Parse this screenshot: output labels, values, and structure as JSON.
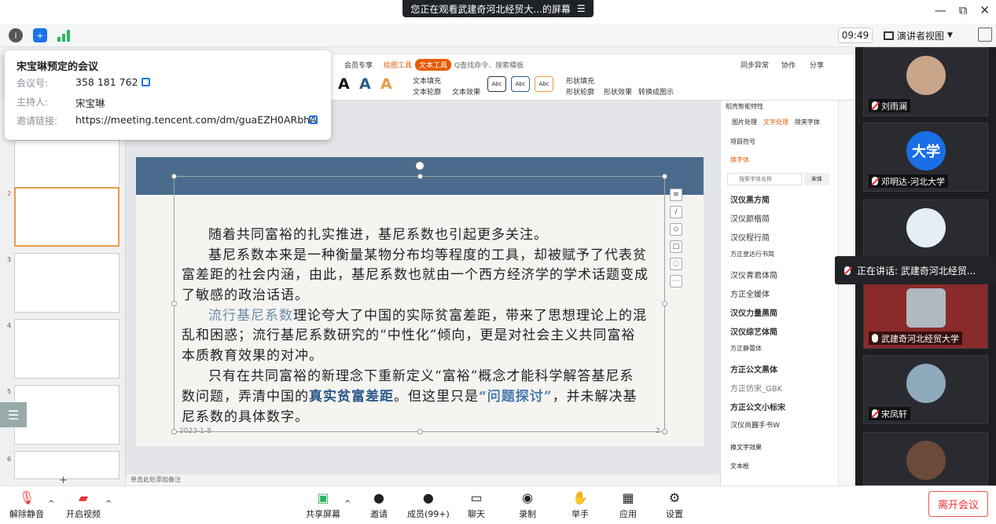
{
  "banner": {
    "text": "您正在观看武建奇河北经贸大...的屏幕",
    "menu_icon": "menu-icon"
  },
  "window": {
    "minimize": "—",
    "restore": "⧉",
    "close": "✕"
  },
  "status": {
    "clock": "09:49",
    "view_mode": "演讲者视图"
  },
  "meeting_info": {
    "title": "宋宝琳预定的会议",
    "id_label": "会议号:",
    "id_value": "358 181 762",
    "host_label": "主持人:",
    "host_value": "宋宝琳",
    "link_label": "邀请链接:",
    "link_value": "https://meeting.tencent.com/dm/guaEZH0ARbhA"
  },
  "ppt": {
    "ribbon_tabs": [
      "会员专享",
      "绘图工具",
      "文本工具",
      "Q查找命令、搜索模板"
    ],
    "ribbon_right": [
      "同步异常",
      "协作",
      "分享"
    ],
    "ribbon_tools": [
      "文本填充",
      "文本轮廓",
      "文本效果",
      "形状填充",
      "形状轮廓",
      "形状效果",
      "转换成图示"
    ],
    "style_boxes": [
      "Abc",
      "Abc",
      "Abc"
    ],
    "thumb_numbers": [
      "2",
      "3",
      "4",
      "5",
      "6"
    ],
    "notes_hint": "单击此处添加备注",
    "slide_date": "2023-1-8",
    "slide_page": "2"
  },
  "slide": {
    "p1": "随着共同富裕的扎实推进，基尼系数也引起更多关注。",
    "p2a": "基尼系数本来是一种衡量某物分布均等程度的工具，却被赋予了代表贫",
    "p2b": "富差距的社会内涵，由此，基尼系数也就由一个西方经济学的学术话题变成",
    "p2c": "了敏感的政治话语。",
    "p3_hl": "流行基尼系数",
    "p3a": "理论夸大了中国的实际贫富差距，带来了思想理论上的混",
    "p3b": "乱和困惑；流行基尼系数研究的“中性化”倾向，更是对社会主义共同富裕",
    "p3c": "本质教育效果的对冲。",
    "p4a": "只有在共同富裕的新理念下重新定义“富裕”概念才能科学解答基尼系",
    "p4b_1": "数问题，弄清中国的",
    "p4b_hl": "真实贫富差距",
    "p4b_2": "。但这里只是",
    "p4b_hl2": "“问题探讨”",
    "p4b_3": "，并未解决基",
    "p4c": "尼系数的具体数字。"
  },
  "font_panel": {
    "header": "稻壳智能特性",
    "tabs": [
      "图片处理",
      "文字处理",
      "除夹字体"
    ],
    "section1": "项目符号",
    "section2": "换字体",
    "search_placeholder": "搜索字体名称",
    "search_btn": "宋体",
    "fonts": [
      "汉仪黑方简",
      "汉仪颜楷简",
      "汉仪程行简",
      "方正皇达行书简",
      "汉仪青君体简",
      "方正全媛体",
      "汉仪力量黑简",
      "汉仪综艺体简",
      "方正静蕾体",
      "方正公文黑体",
      "方正仿宋_GBK",
      "方正公文小标宋",
      "汉仪尚巍手书W"
    ],
    "section3": "换文字效果",
    "section4": "文本框"
  },
  "participants": [
    {
      "name": "刘雨澜"
    },
    {
      "name": "邓明达-河北大学",
      "avatar_text": "大学"
    },
    {
      "name": ""
    },
    {
      "name": "武建奇河北经贸大学"
    },
    {
      "name": "宋凤轩"
    },
    {
      "name": ""
    }
  ],
  "speaking": "正在讲话: 武建奇河北经贸...",
  "toolbar": {
    "mute": "解除静音",
    "video": "开启视频",
    "share": "共享屏幕",
    "invite": "邀请",
    "members": "成员(99+)",
    "chat": "聊天",
    "record": "录制",
    "raise": "举手",
    "apps": "应用",
    "settings": "设置",
    "leave": "离开会议"
  },
  "colors": {
    "accent": "#1a73e8",
    "leave": "#e33333",
    "slide_header": "#4a6b8c",
    "highlight_text": "#2d5a8c"
  }
}
